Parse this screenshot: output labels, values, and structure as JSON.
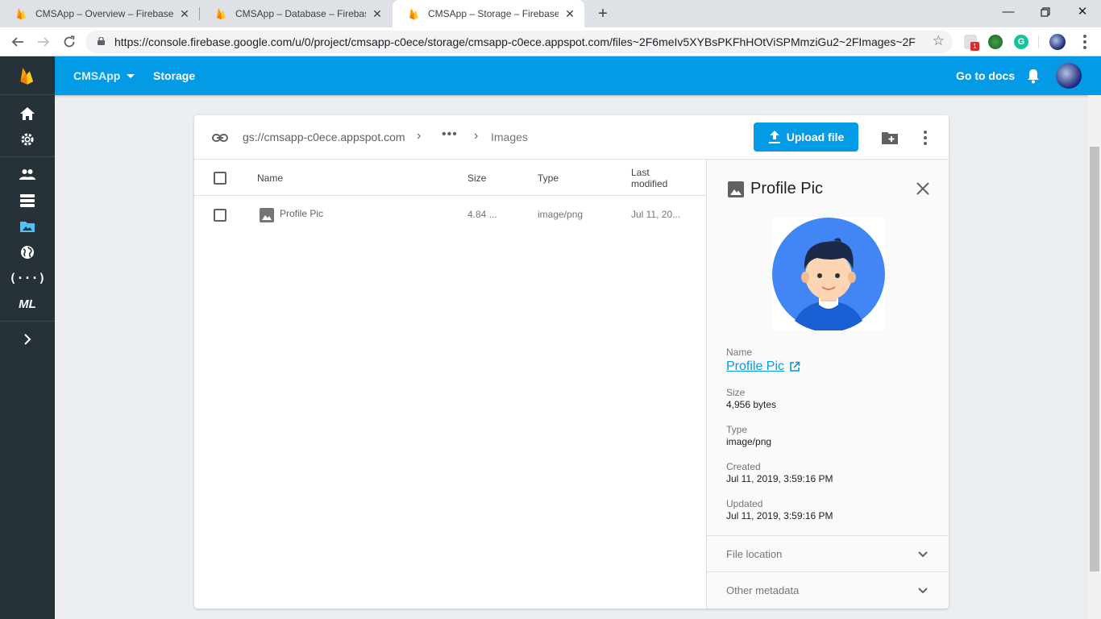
{
  "browser": {
    "tabs": [
      {
        "title": "CMSApp – Overview – Firebase c",
        "active": false
      },
      {
        "title": "CMSApp – Database – Firebase c",
        "active": false
      },
      {
        "title": "CMSApp – Storage – Firebase co",
        "active": true
      }
    ],
    "url": "https://console.firebase.google.com/u/0/project/cmsapp-c0ece/storage/cmsapp-c0ece.appspot.com/files~2F6meIv5XYBsPKFhHOtViSPMmziGu2~2FImages~2F",
    "extension_badge": "1"
  },
  "appbar": {
    "project": "CMSApp",
    "section": "Storage",
    "docs_link": "Go to docs"
  },
  "storage": {
    "bucket": "gs://cmsapp-c0ece.appspot.com",
    "ellipsis": "•••",
    "current_folder": "Images",
    "upload_label": "Upload file",
    "columns": {
      "name": "Name",
      "size": "Size",
      "type": "Type",
      "last_modified_1": "Last",
      "last_modified_2": "modified"
    },
    "files": [
      {
        "name": "Profile Pic",
        "size": "4.84 ...",
        "type": "image/png",
        "modified": "Jul 11, 20..."
      }
    ]
  },
  "detail": {
    "title": "Profile Pic",
    "name_label": "Name",
    "name_value": "Profile Pic",
    "size_label": "Size",
    "size_value": "4,956 bytes",
    "type_label": "Type",
    "type_value": "image/png",
    "created_label": "Created",
    "created_value": "Jul 11, 2019, 3:59:16 PM",
    "updated_label": "Updated",
    "updated_value": "Jul 11, 2019, 3:59:16 PM",
    "file_location_label": "File location",
    "other_metadata_label": "Other metadata"
  },
  "colors": {
    "firebase_blue": "#039be5",
    "sidebar": "#263238"
  }
}
